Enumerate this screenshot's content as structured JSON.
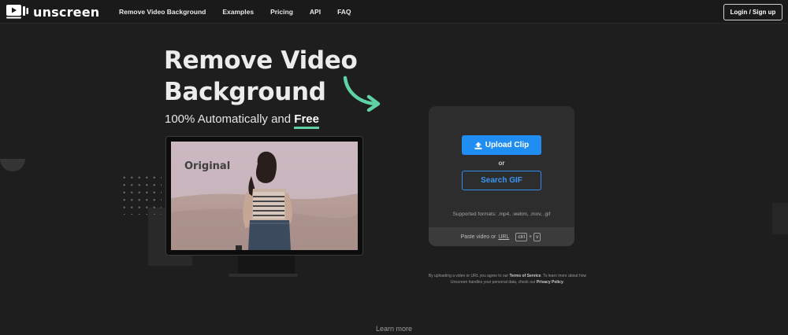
{
  "brand": {
    "name": "unscreen"
  },
  "nav": {
    "links": [
      "Remove Video Background",
      "Examples",
      "Pricing",
      "API",
      "FAQ"
    ],
    "login_label": "Login / Sign up"
  },
  "hero": {
    "title_line1": "Remove Video",
    "title_line2": "Background",
    "subtitle_prefix": "100% Automatically and",
    "subtitle_free": "Free",
    "preview_label": "Original"
  },
  "upload": {
    "upload_label": "Upload Clip",
    "or_label": "or",
    "search_label": "Search GIF",
    "formats": "Supported formats: .mp4, .webm, .mov, .gif",
    "paste_prefix": "Paste video or",
    "paste_url": "URL",
    "key_ctrl": "ctrl",
    "key_plus": "+",
    "key_v": "v"
  },
  "terms": {
    "t1": "By uploading a video or URL you agree to our",
    "t2": "Terms of Service",
    "t3": ". To learn more about how Unscreen handles your personal data, check our",
    "t4": "Privacy Policy",
    "t5": "."
  },
  "footer": {
    "learn_more": "Learn more"
  },
  "colors": {
    "accent_blue": "#1f8df1",
    "accent_green": "#5ed1a5",
    "background": "#1e1e1e"
  },
  "icons": {
    "logo": "play-screen-icon",
    "upload": "upload-arrow-icon",
    "arrow": "curved-arrow-icon"
  }
}
